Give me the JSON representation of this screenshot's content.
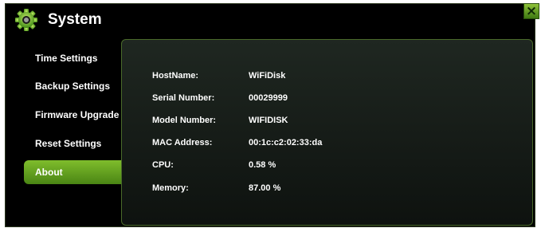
{
  "window": {
    "title": "System",
    "close_glyph": "×"
  },
  "icons": {
    "header": "gear-icon",
    "close": "close-icon"
  },
  "colors": {
    "accent": "#6aaa1e",
    "background": "#000000",
    "text": "#ffffff"
  },
  "nav": {
    "items": [
      {
        "label": "Time Settings"
      },
      {
        "label": "Backup Settings"
      },
      {
        "label": "Firmware Upgrade"
      },
      {
        "label": "Reset Settings"
      },
      {
        "label": "About"
      }
    ],
    "active": "About"
  },
  "about": {
    "rows": [
      {
        "label": "HostName:",
        "value": "WiFiDisk"
      },
      {
        "label": "Serial Number:",
        "value": "00029999"
      },
      {
        "label": "Model Number:",
        "value": "WIFIDISK"
      },
      {
        "label": "MAC Address:",
        "value": "00:1c:c2:02:33:da"
      },
      {
        "label": "CPU:",
        "value": "0.58 %"
      },
      {
        "label": "Memory:",
        "value": "87.00 %"
      }
    ]
  }
}
